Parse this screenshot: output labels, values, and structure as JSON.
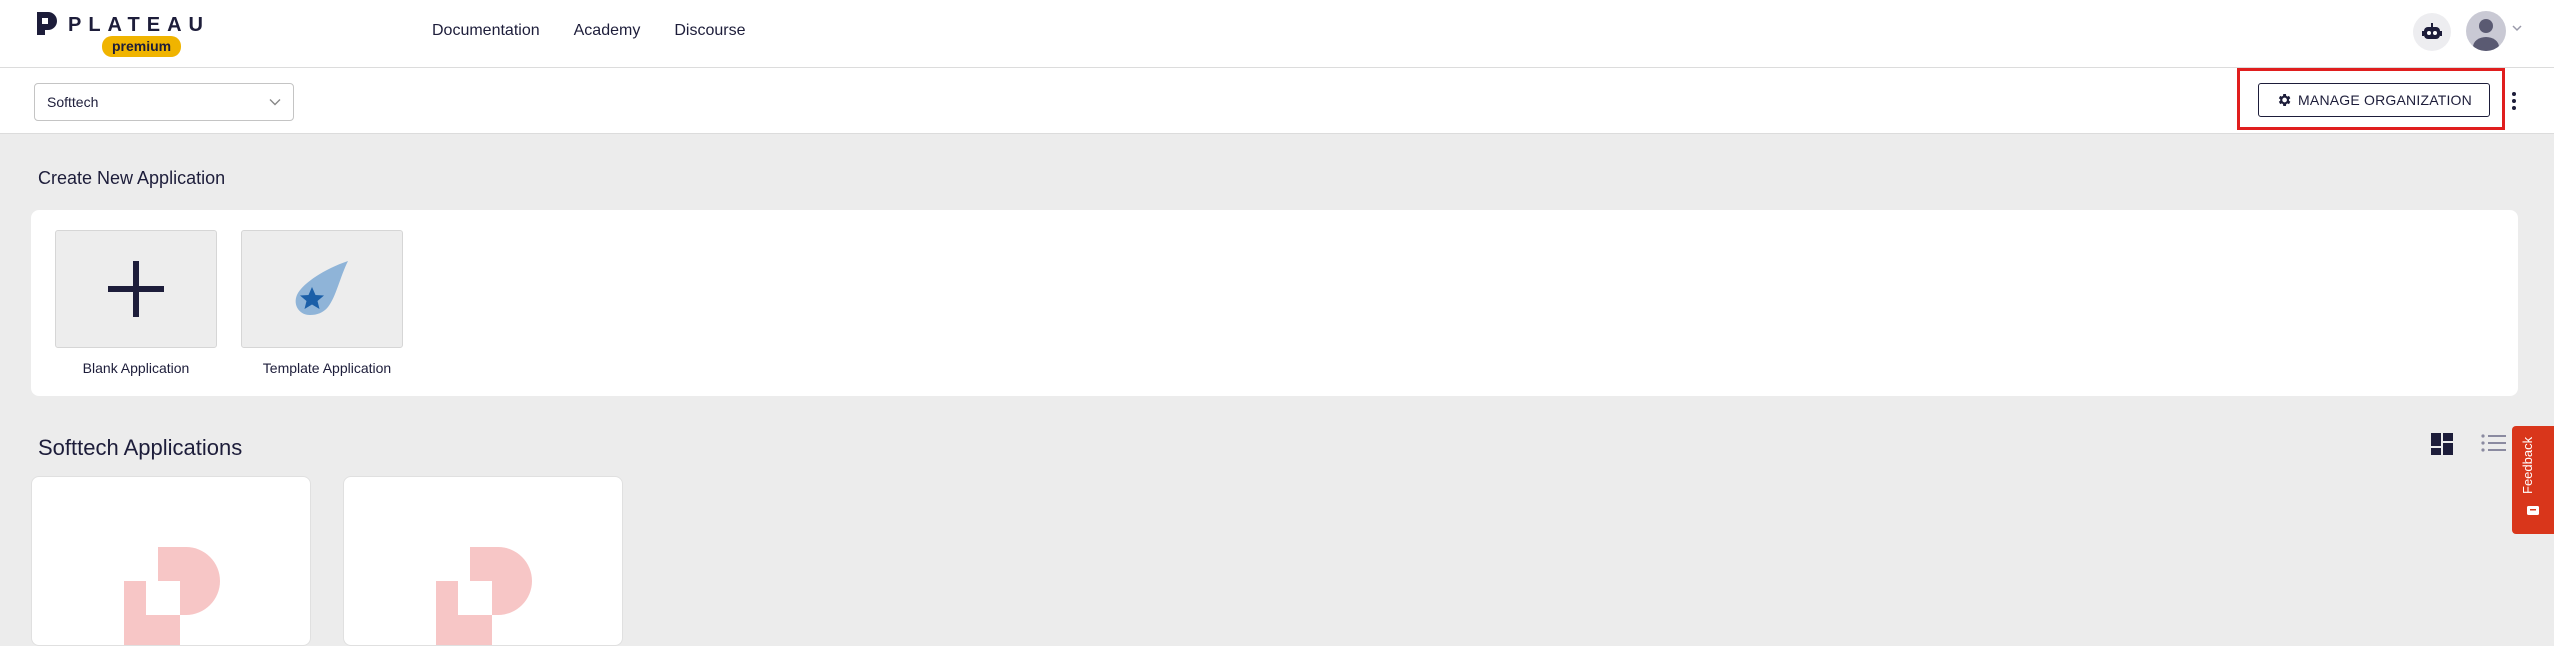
{
  "header": {
    "logo_text": "PLATEAU",
    "logo_badge": "premium",
    "nav": [
      "Documentation",
      "Academy",
      "Discourse"
    ],
    "bot_icon": "robot-icon",
    "avatar_icon": "user-avatar-icon"
  },
  "org_bar": {
    "selected_org": "Softtech",
    "manage_button": "MANAGE ORGANIZATION",
    "highlight_color": "#e01e1e"
  },
  "create": {
    "title": "Create New Application",
    "tiles": [
      {
        "label": "Blank Application",
        "icon": "plus-icon"
      },
      {
        "label": "Template Application",
        "icon": "template-star-icon"
      }
    ]
  },
  "apps": {
    "title": "Softtech Applications",
    "view_modes": [
      "grid-view-icon",
      "list-view-icon"
    ],
    "accent": "#f7c6c6"
  },
  "feedback": {
    "label": "Feedback",
    "color": "#d9361b"
  }
}
